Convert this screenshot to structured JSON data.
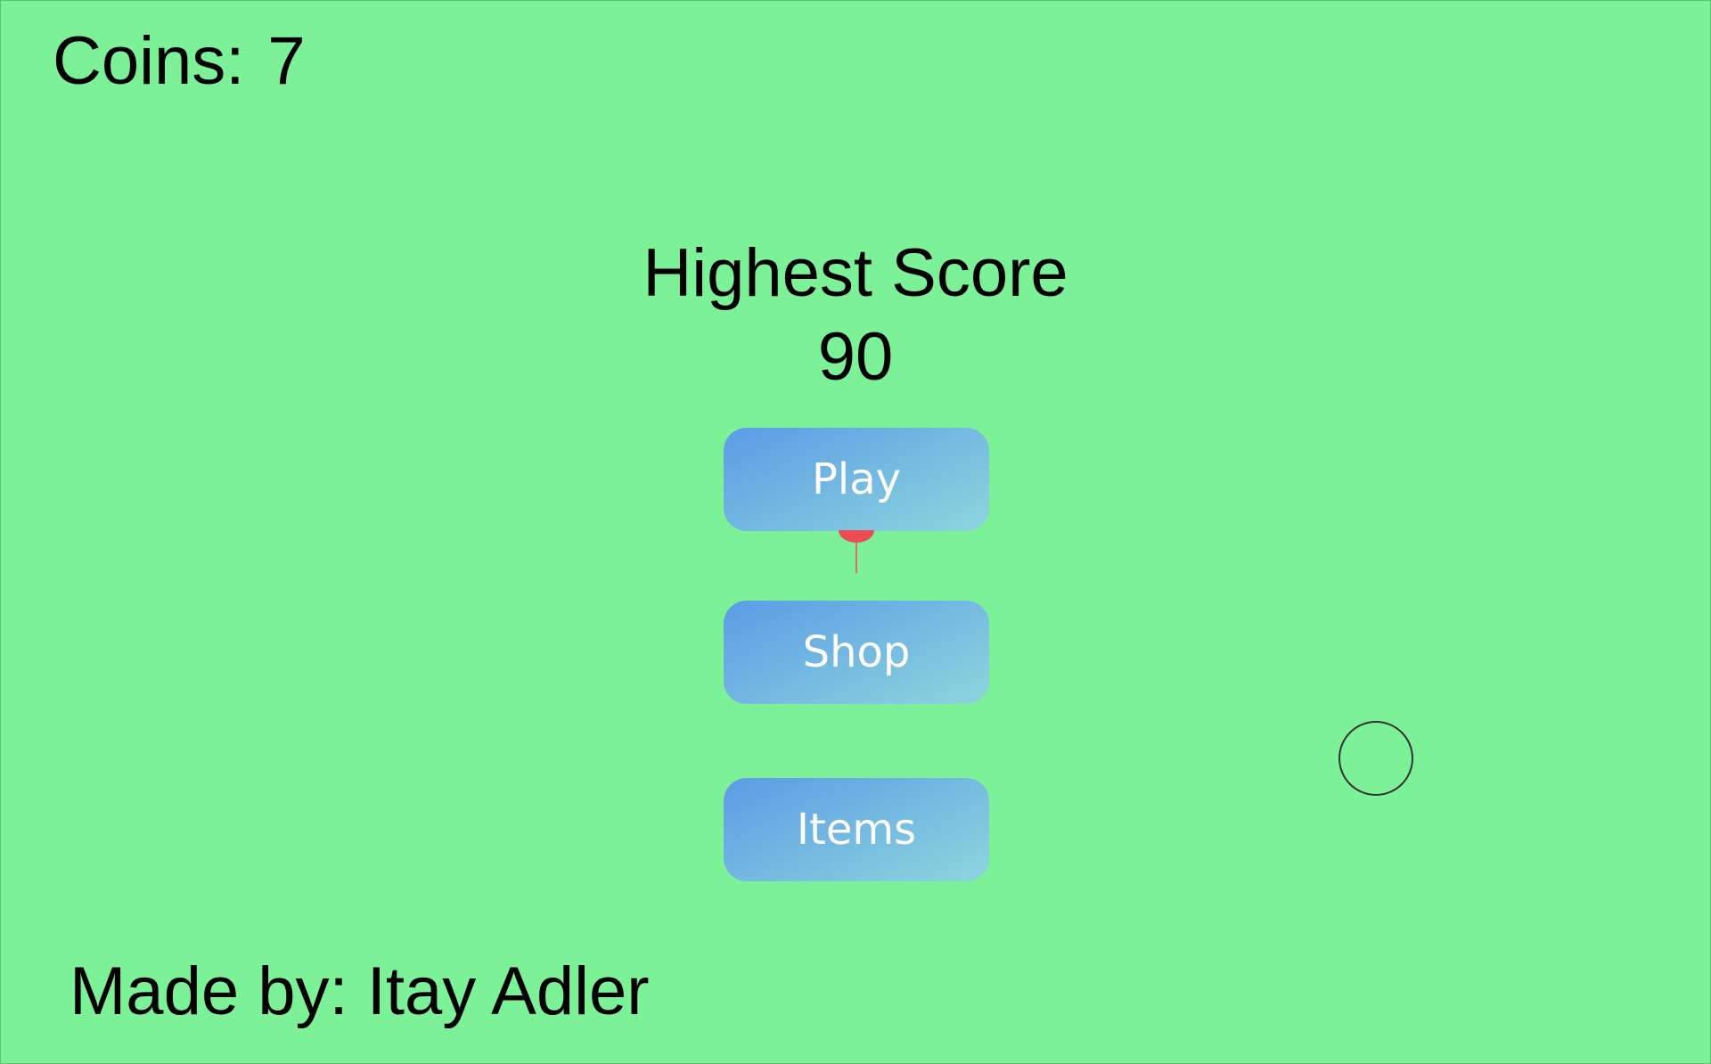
{
  "colors": {
    "background": "#7cf197",
    "button_gradient_start": "#5b9ce6",
    "button_gradient_end": "#8dd6dc",
    "button_text": "#ffffff",
    "balloon": "#ee4a55",
    "circle_outline": "#333333"
  },
  "hud": {
    "coins_label": "Coins:",
    "coins_value": "7"
  },
  "score": {
    "title": "Highest Score",
    "value": "90"
  },
  "menu": {
    "play_label": "Play",
    "shop_label": "Shop",
    "items_label": "Items"
  },
  "sprites": {
    "balloon_icon": "balloon-icon",
    "target_circle": "circle-outline-icon"
  },
  "footer": {
    "credits": "Made by: Itay Adler"
  }
}
